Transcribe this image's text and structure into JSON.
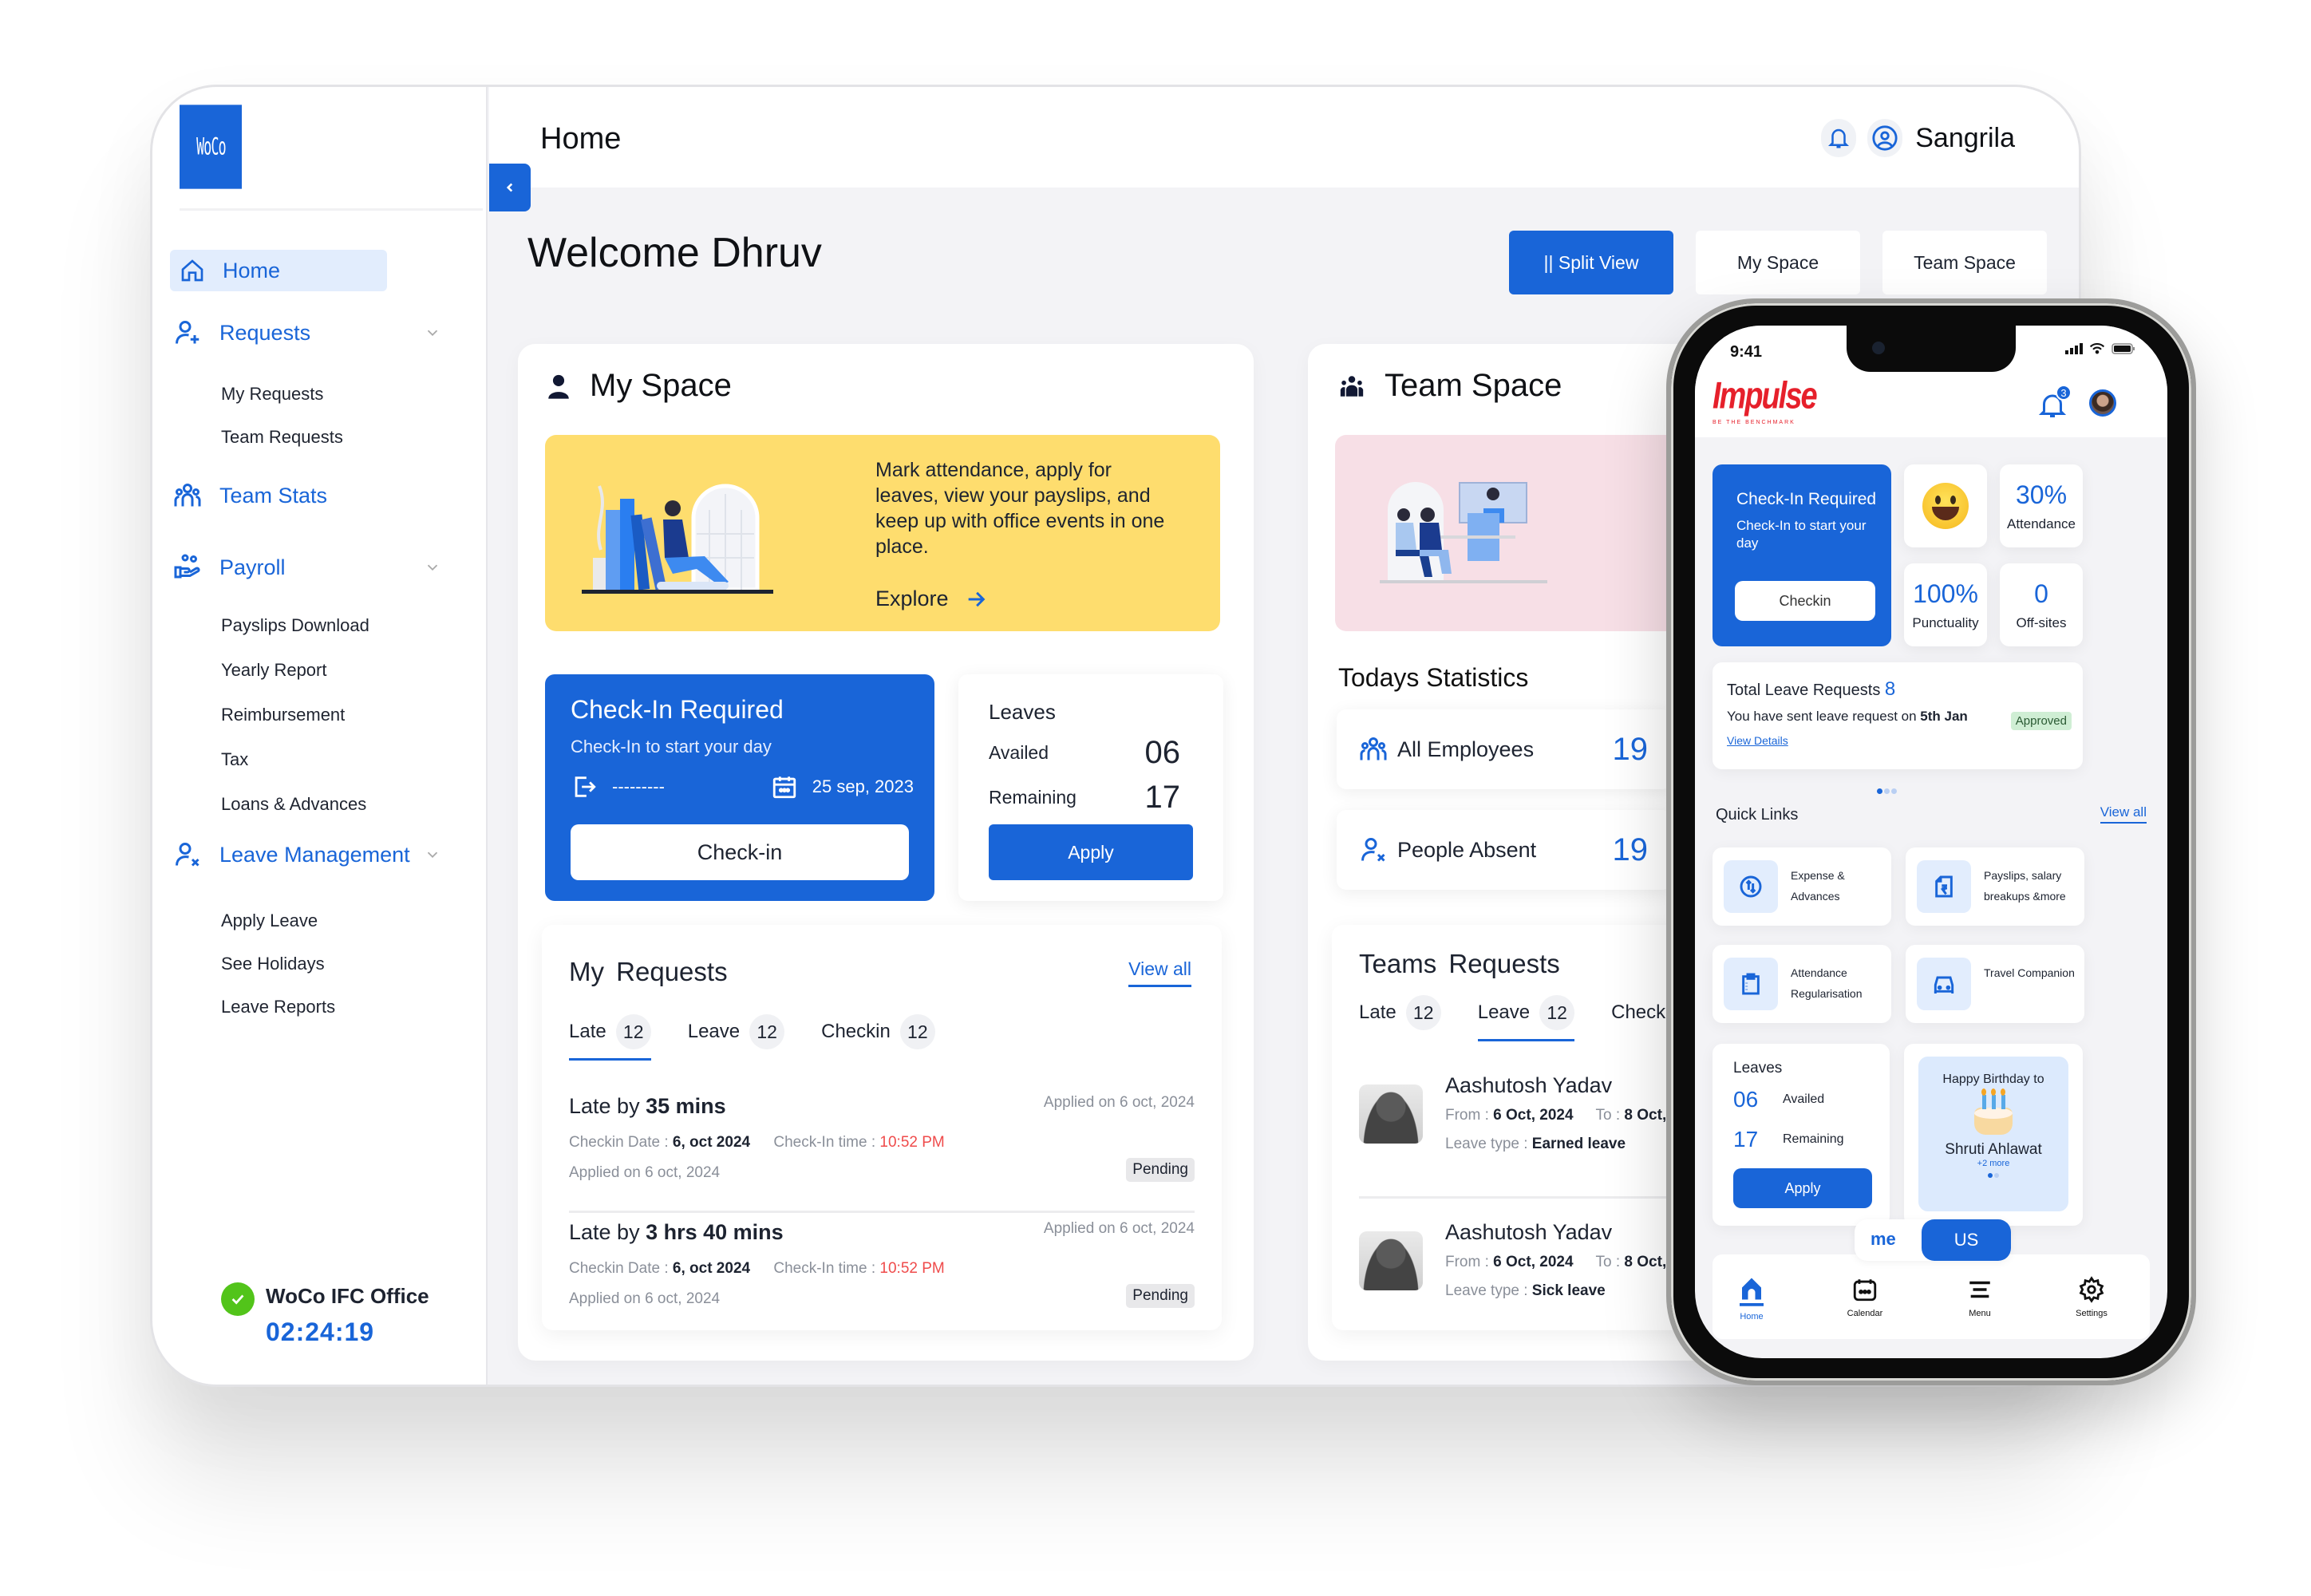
{
  "app": {
    "logo_text": "WoCo",
    "page_title": "Home",
    "user_name": "Sangrila",
    "welcome": "Welcome Dhruv"
  },
  "sidebar": {
    "home_label": "Home",
    "groups": [
      {
        "label": "Requests",
        "icon": "user-plus-icon",
        "items": [
          "My Requests",
          "Team Requests"
        ]
      },
      {
        "label": "Team Stats",
        "icon": "team-icon",
        "items": []
      },
      {
        "label": "Payroll",
        "icon": "payroll-hand-icon",
        "items": [
          "Payslips Download",
          "Yearly Report",
          "Reimbursement",
          "Tax",
          "Loans & Advances"
        ]
      },
      {
        "label": "Leave Management",
        "icon": "user-x-icon",
        "items": [
          "Apply Leave",
          "See Holidays",
          "Leave Reports"
        ]
      }
    ],
    "office": {
      "name": "WoCo IFC Office",
      "timer": "02:24:19"
    }
  },
  "view_buttons": [
    {
      "label": "|| Split View",
      "active": true
    },
    {
      "label": "My Space",
      "active": false
    },
    {
      "label": "Team Space",
      "active": false
    }
  ],
  "my_space": {
    "title": "My Space",
    "banner": {
      "text": "Mark attendance, apply for leaves, view your payslips, and keep up with office events in one place.",
      "explore": "Explore"
    },
    "checkin": {
      "title": "Check-In Required",
      "subtitle": "Check-In to start your day",
      "time_placeholder": "---------",
      "date": "25 sep, 2023",
      "button": "Check-in"
    },
    "leaves": {
      "title": "Leaves",
      "availed_label": "Availed",
      "availed": "06",
      "remaining_label": "Remaining",
      "remaining": "17",
      "button": "Apply"
    },
    "requests": {
      "title": "My  Requests",
      "view_all": "View all",
      "tabs": [
        {
          "label": "Late",
          "count": "12",
          "active": true
        },
        {
          "label": "Leave",
          "count": "12",
          "active": false
        },
        {
          "label": "Checkin",
          "count": "12",
          "active": false
        }
      ],
      "items": [
        {
          "prefix": "Late by ",
          "duration": "35 mins",
          "applied_right": "Applied on 6 oct, 2024",
          "date_label": "Checkin Date : ",
          "date": "6, oct 2024",
          "time_label": "Check-In time : ",
          "time": "10:52 PM",
          "applied_left": "Applied on 6 oct, 2024",
          "status": "Pending"
        },
        {
          "prefix": "Late by ",
          "duration": "3 hrs 40 mins",
          "applied_right": "Applied on 6 oct, 2024",
          "date_label": "Checkin Date : ",
          "date": "6, oct 2024",
          "time_label": "Check-In time : ",
          "time": "10:52 PM",
          "applied_left": "Applied on 6 oct, 2024",
          "status": "Pending"
        }
      ]
    }
  },
  "team_space": {
    "title": "Team Space",
    "stats_title": "Todays Statistics",
    "stats": [
      {
        "label": "All Employees",
        "value": "19"
      },
      {
        "label": "People Absent",
        "value": "19"
      }
    ],
    "requests": {
      "title": "Teams  Requests",
      "tabs": [
        {
          "label": "Late",
          "count": "12",
          "active": false
        },
        {
          "label": "Leave",
          "count": "12",
          "active": true
        },
        {
          "label": "Checki",
          "count": "",
          "active": false
        }
      ],
      "items": [
        {
          "name": "Aashutosh Yadav",
          "from_label": "From : ",
          "from": "6 Oct, 2024",
          "to_label": "To : ",
          "to": "8 Oct,",
          "type_label": "Leave type : ",
          "type": "Earned leave"
        },
        {
          "name": "Aashutosh Yadav",
          "from_label": "From : ",
          "from": "6 Oct, 2024",
          "to_label": "To : ",
          "to": "8 Oct,",
          "type_label": "Leave type : ",
          "type": "Sick leave"
        }
      ]
    }
  },
  "phone": {
    "time": "9:41",
    "brand": "Impulse",
    "brand_tagline": "BE THE BENCHMARK",
    "notification_count": "3",
    "checkin": {
      "title": "Check-In Required",
      "subtitle": "Check-In to start your day",
      "button": "Checkin"
    },
    "tiles": [
      {
        "value": "30%",
        "label": "Attendance"
      },
      {
        "value": "100%",
        "label": "Punctuality"
      },
      {
        "value": "0",
        "label": "Off-sites"
      }
    ],
    "leave_requests": {
      "title": "Total Leave Requests",
      "count": "8",
      "text": "You have sent leave request on ",
      "date": "5th Jan",
      "status": "Approved",
      "link": "View Details"
    },
    "quick_links": {
      "title": "Quick Links",
      "view_all": "View all",
      "items": [
        {
          "label": "Expense & Advances",
          "icon": "exchange-icon"
        },
        {
          "label": "Payslips, salary breakups &more",
          "icon": "rupee-document-icon"
        },
        {
          "label": "Attendance Regularisation",
          "icon": "clipboard-icon"
        },
        {
          "label": "Travel Companion",
          "icon": "car-icon"
        }
      ]
    },
    "leaves": {
      "title": "Leaves",
      "availed": "06",
      "availed_label": "Availed",
      "remaining": "17",
      "remaining_label": "Remaining",
      "button": "Apply"
    },
    "birthday": {
      "heading": "Happy Birthday to",
      "name": "Shruti Ahlawat",
      "more": "+2 more"
    },
    "toggle": {
      "me": "me",
      "us": "US"
    },
    "nav": [
      {
        "label": "Home",
        "active": true
      },
      {
        "label": "Calendar",
        "active": false
      },
      {
        "label": "Menu",
        "active": false
      },
      {
        "label": "Settings",
        "active": false
      }
    ]
  }
}
